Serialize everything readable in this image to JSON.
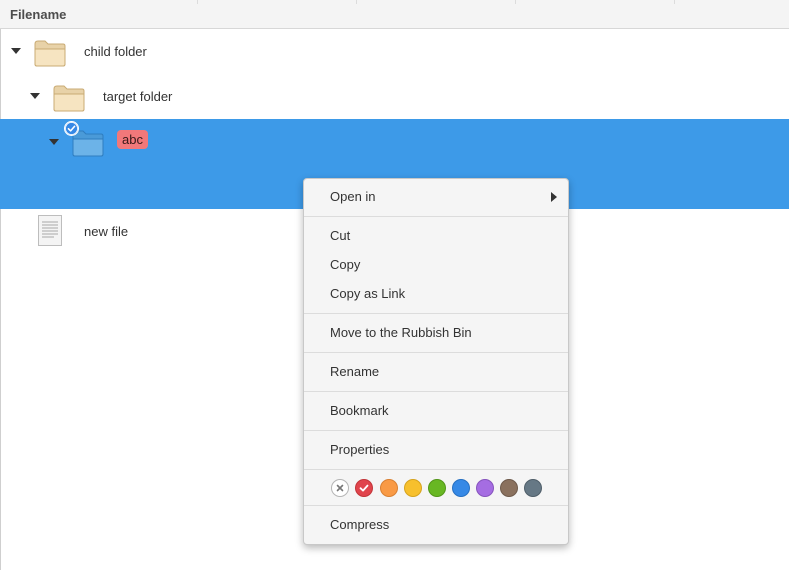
{
  "header": {
    "filename_column": "Filename"
  },
  "tree": {
    "rows": [
      {
        "label": "child folder",
        "expanded": true,
        "icon": "folder-icon"
      },
      {
        "label": "target folder",
        "expanded": true,
        "icon": "folder-icon"
      },
      {
        "label": "abc",
        "expanded": true,
        "icon": "folder-icon",
        "selected": true,
        "tag_color": "#f2787a"
      },
      {
        "label": "new file",
        "icon": "text-file-icon"
      }
    ]
  },
  "context_menu": {
    "items": {
      "open_in": "Open in",
      "cut": "Cut",
      "copy": "Copy",
      "copy_as_link": "Copy as Link",
      "move_to_bin": "Move to the Rubbish Bin",
      "rename": "Rename",
      "bookmark": "Bookmark",
      "properties": "Properties",
      "compress": "Compress"
    },
    "color_tags": [
      {
        "name": "none",
        "color": "#ffffff"
      },
      {
        "name": "red",
        "color": "#e0444c",
        "selected": true
      },
      {
        "name": "orange",
        "color": "#f99a45"
      },
      {
        "name": "yellow",
        "color": "#f7c02d"
      },
      {
        "name": "green",
        "color": "#68b723"
      },
      {
        "name": "blue",
        "color": "#3689e6"
      },
      {
        "name": "purple",
        "color": "#a56de2"
      },
      {
        "name": "brown",
        "color": "#8a715e"
      },
      {
        "name": "slate",
        "color": "#667885"
      }
    ]
  },
  "colors": {
    "selection": "#3d9ae8",
    "menu_background": "#f5f5f5"
  }
}
